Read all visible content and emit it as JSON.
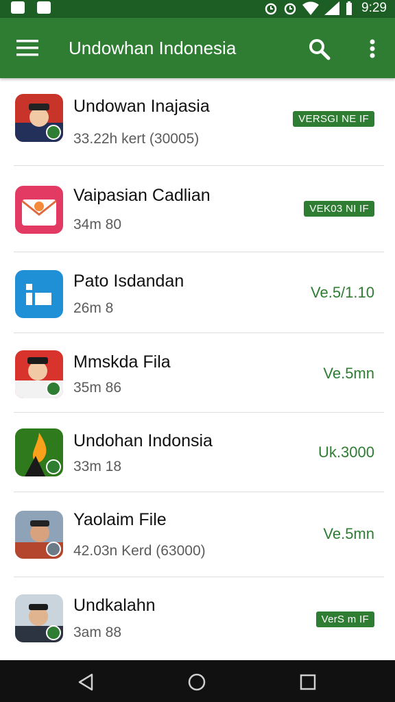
{
  "status_bar": {
    "time": "9:29",
    "left_icons": [
      "notification-icon",
      "notification-icon"
    ],
    "right_icons": [
      "alarm-icon",
      "alarm-icon",
      "wifi-icon",
      "signal-icon",
      "battery-icon"
    ]
  },
  "app_bar": {
    "title": "Undowhan Indonesia",
    "color": "#2e7d32"
  },
  "apps": [
    {
      "name": "Undowan Inajasia",
      "meta": "33.22h kert (30005)",
      "version": "VERSGI NE IF",
      "version_style": "badge"
    },
    {
      "name": "Vaipasian Cadlian",
      "meta": "34m 80",
      "version": "VEK03 NI IF",
      "version_style": "badge"
    },
    {
      "name": "Pato Isdandan",
      "meta": "26m 8",
      "version": "Ve.5/1.10",
      "version_style": "text"
    },
    {
      "name": "Mmskda Fila",
      "meta": "35m 86",
      "version": "Ve.5mn",
      "version_style": "text"
    },
    {
      "name": "Undohan Indonsia",
      "meta": "33m 18",
      "version": "Uk.3000",
      "version_style": "text"
    },
    {
      "name": "Yaolaim File",
      "meta": "42.03n Kerd (63000)",
      "version": "Ve.5mn",
      "version_style": "text"
    },
    {
      "name": "Undkalahn",
      "meta": "3am 88",
      "version": "VerS m IF",
      "version_style": "badge"
    }
  ]
}
